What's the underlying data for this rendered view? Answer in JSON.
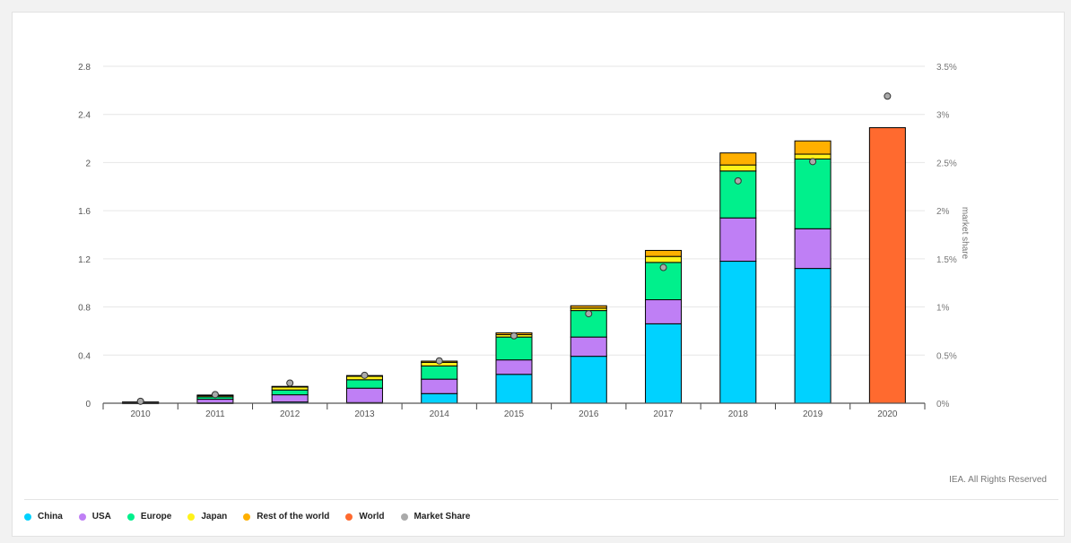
{
  "chart_data": {
    "type": "bar",
    "stacked": true,
    "categories": [
      "2010",
      "2011",
      "2012",
      "2013",
      "2014",
      "2015",
      "2016",
      "2017",
      "2018",
      "2019",
      "2020"
    ],
    "series": [
      {
        "name": "China",
        "color": "#00d2ff",
        "values": [
          0.002,
          0.003,
          0.01,
          0.005,
          0.08,
          0.24,
          0.39,
          0.66,
          1.18,
          1.12,
          0
        ]
      },
      {
        "name": "USA",
        "color": "#bf7ff5",
        "values": [
          0.004,
          0.03,
          0.06,
          0.12,
          0.12,
          0.12,
          0.16,
          0.2,
          0.36,
          0.33,
          0
        ]
      },
      {
        "name": "Europe",
        "color": "#00f08c",
        "values": [
          0.003,
          0.02,
          0.04,
          0.07,
          0.11,
          0.19,
          0.22,
          0.31,
          0.39,
          0.58,
          0
        ]
      },
      {
        "name": "Japan",
        "color": "#fff21a",
        "values": [
          0.001,
          0.01,
          0.025,
          0.03,
          0.03,
          0.02,
          0.02,
          0.05,
          0.05,
          0.04,
          0
        ]
      },
      {
        "name": "Rest of the world",
        "color": "#ffb000",
        "values": [
          0,
          0.005,
          0.005,
          0.005,
          0.01,
          0.015,
          0.02,
          0.05,
          0.1,
          0.11,
          0
        ]
      },
      {
        "name": "World",
        "color": "#ff6a2f",
        "values": [
          0,
          0,
          0,
          0,
          0,
          0,
          0,
          0,
          0,
          0,
          2.29
        ]
      }
    ],
    "market_share": {
      "name": "Market Share",
      "color": "#aaaaaa",
      "values": [
        0.02,
        0.09,
        0.21,
        0.29,
        0.44,
        0.7,
        0.93,
        1.41,
        2.31,
        2.51,
        3.19
      ]
    },
    "ylim": [
      0,
      2.8
    ],
    "yticks": [
      "0",
      "0.4",
      "0.8",
      "1.2",
      "1.6",
      "2",
      "2.4",
      "2.8"
    ],
    "y2lim": [
      0,
      3.5
    ],
    "y2ticks": [
      "0%",
      "0.5%",
      "1%",
      "1.5%",
      "2%",
      "2.5%",
      "3%",
      "3.5%"
    ],
    "y2label": "market share",
    "grid": true,
    "legend_position": "bottom-left"
  },
  "credit": "IEA. All Rights Reserved"
}
